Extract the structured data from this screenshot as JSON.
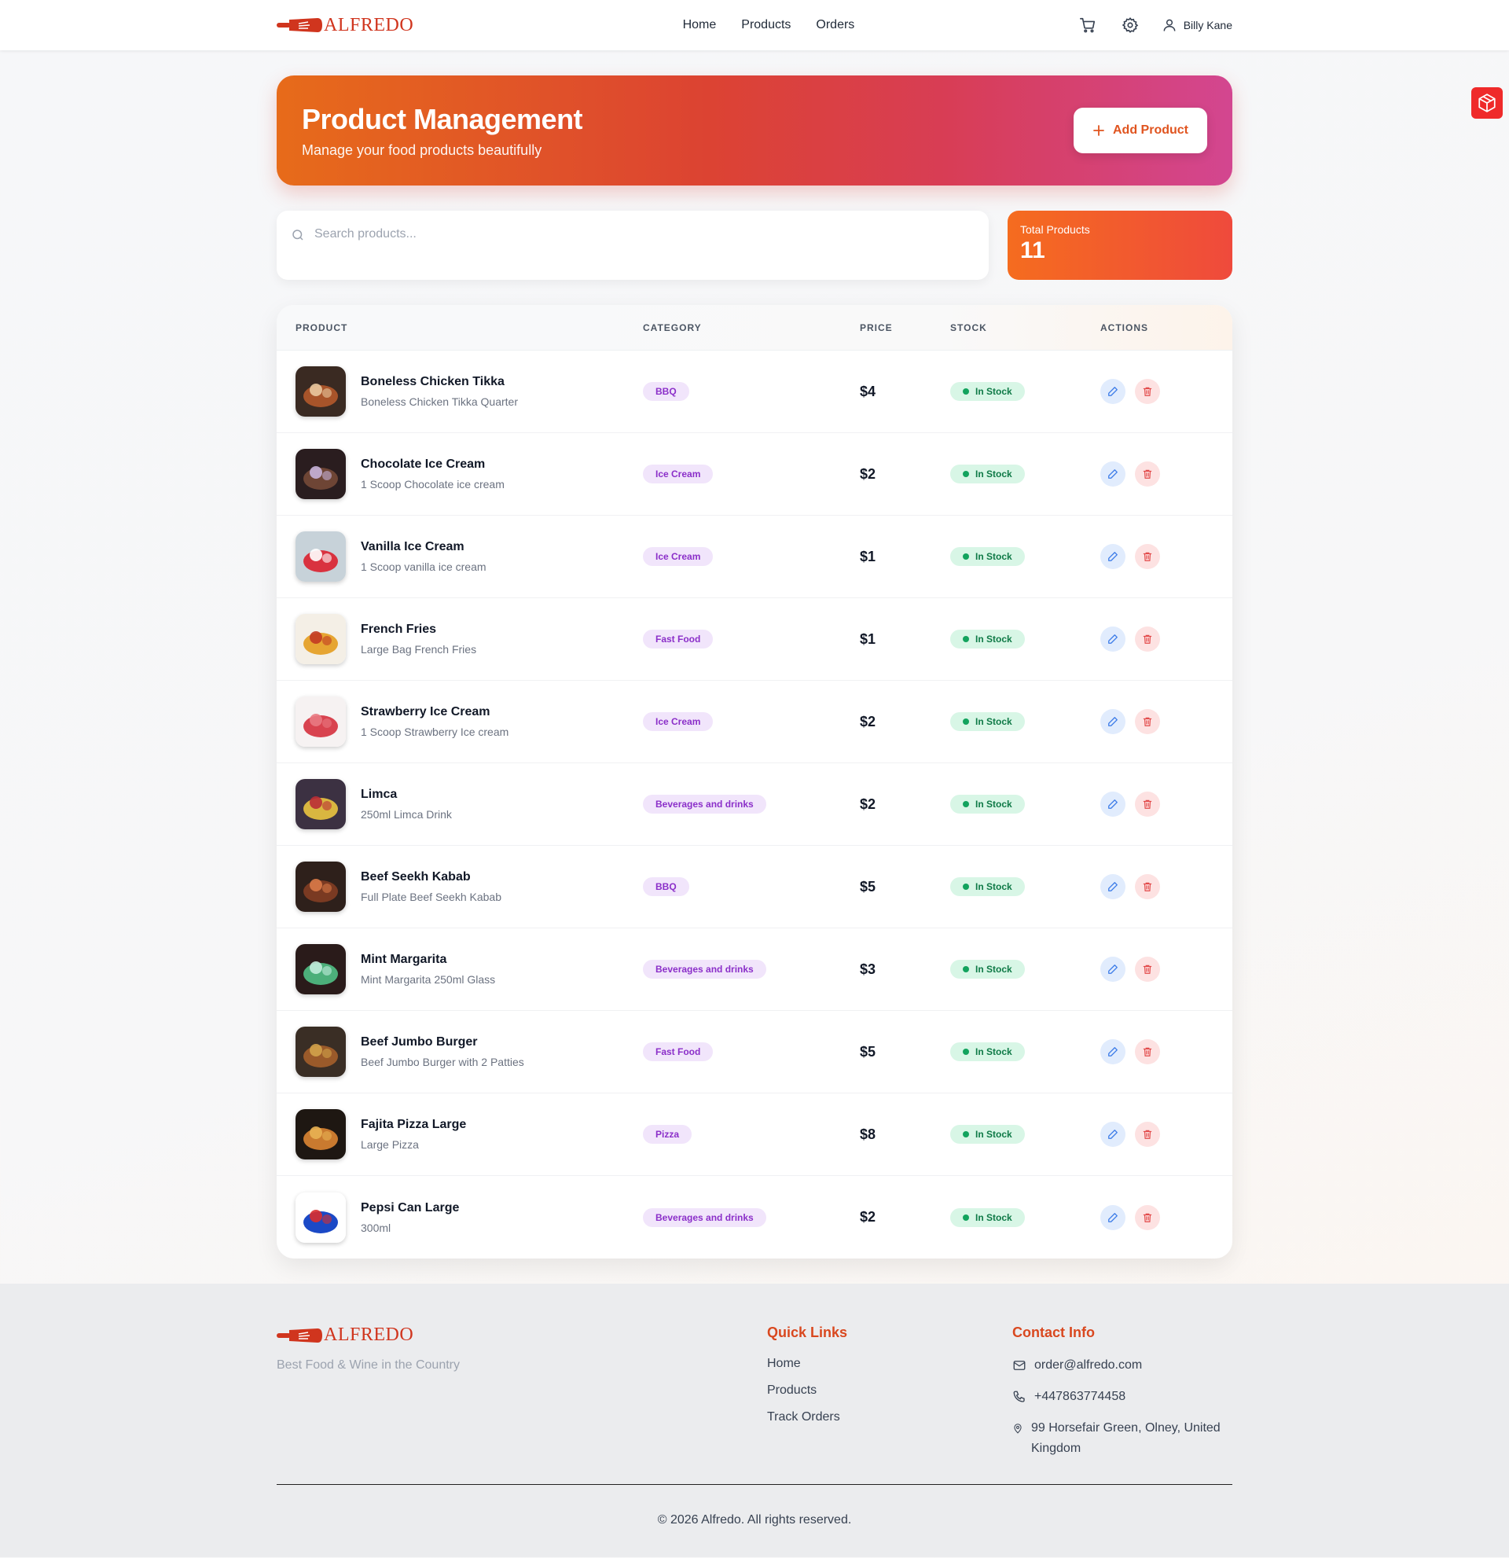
{
  "brand": {
    "name": "ALFREDO",
    "accent": "#d0351e"
  },
  "nav": {
    "links": [
      "Home",
      "Products",
      "Orders"
    ],
    "icons": [
      "cart-icon",
      "gear-icon",
      "user-icon"
    ],
    "user_name": "Billy Kane"
  },
  "hero": {
    "title": "Product Management",
    "subtitle": "Manage your food products beautifully",
    "add_label": "Add Product"
  },
  "search": {
    "placeholder": "Search products..."
  },
  "stats": {
    "total_label": "Total Products",
    "total_value": "11"
  },
  "table": {
    "headers": [
      "PRODUCT",
      "CATEGORY",
      "PRICE",
      "STOCK",
      "ACTIONS"
    ],
    "rows": [
      {
        "name": "Boneless Chicken Tikka",
        "desc": "Boneless Chicken Tikka Quarter",
        "category": "BBQ",
        "price": "$4",
        "stock": "In Stock"
      },
      {
        "name": "Chocolate Ice Cream",
        "desc": "1 Scoop Chocolate ice cream",
        "category": "Ice Cream",
        "price": "$2",
        "stock": "In Stock"
      },
      {
        "name": "Vanilla Ice Cream",
        "desc": "1 Scoop vanilla ice cream",
        "category": "Ice Cream",
        "price": "$1",
        "stock": "In Stock"
      },
      {
        "name": "French Fries",
        "desc": "Large Bag French Fries",
        "category": "Fast Food",
        "price": "$1",
        "stock": "In Stock"
      },
      {
        "name": "Strawberry Ice Cream",
        "desc": "1 Scoop Strawberry Ice cream",
        "category": "Ice Cream",
        "price": "$2",
        "stock": "In Stock"
      },
      {
        "name": "Limca",
        "desc": "250ml Limca Drink",
        "category": "Beverages and drinks",
        "price": "$2",
        "stock": "In Stock"
      },
      {
        "name": "Beef Seekh Kabab",
        "desc": "Full Plate Beef Seekh Kabab",
        "category": "BBQ",
        "price": "$5",
        "stock": "In Stock"
      },
      {
        "name": "Mint Margarita",
        "desc": "Mint Margarita 250ml Glass",
        "category": "Beverages and drinks",
        "price": "$3",
        "stock": "In Stock"
      },
      {
        "name": "Beef Jumbo Burger",
        "desc": "Beef Jumbo Burger with 2 Patties",
        "category": "Fast Food",
        "price": "$5",
        "stock": "In Stock"
      },
      {
        "name": "Fajita Pizza Large",
        "desc": "Large Pizza",
        "category": "Pizza",
        "price": "$8",
        "stock": "In Stock"
      },
      {
        "name": "Pepsi Can Large",
        "desc": "300ml",
        "category": "Beverages and drinks",
        "price": "$2",
        "stock": "In Stock"
      }
    ]
  },
  "footer": {
    "tagline": "Best Food & Wine in the Country",
    "quick_links_title": "Quick Links",
    "quick_links": [
      "Home",
      "Products",
      "Track Orders"
    ],
    "contact_title": "Contact Info",
    "email": "order@alfredo.com",
    "phone": "+447863774458",
    "address": "99 Horsefair Green, Olney, United Kingdom",
    "copyright": "© 2026 Alfredo. All rights reserved."
  }
}
